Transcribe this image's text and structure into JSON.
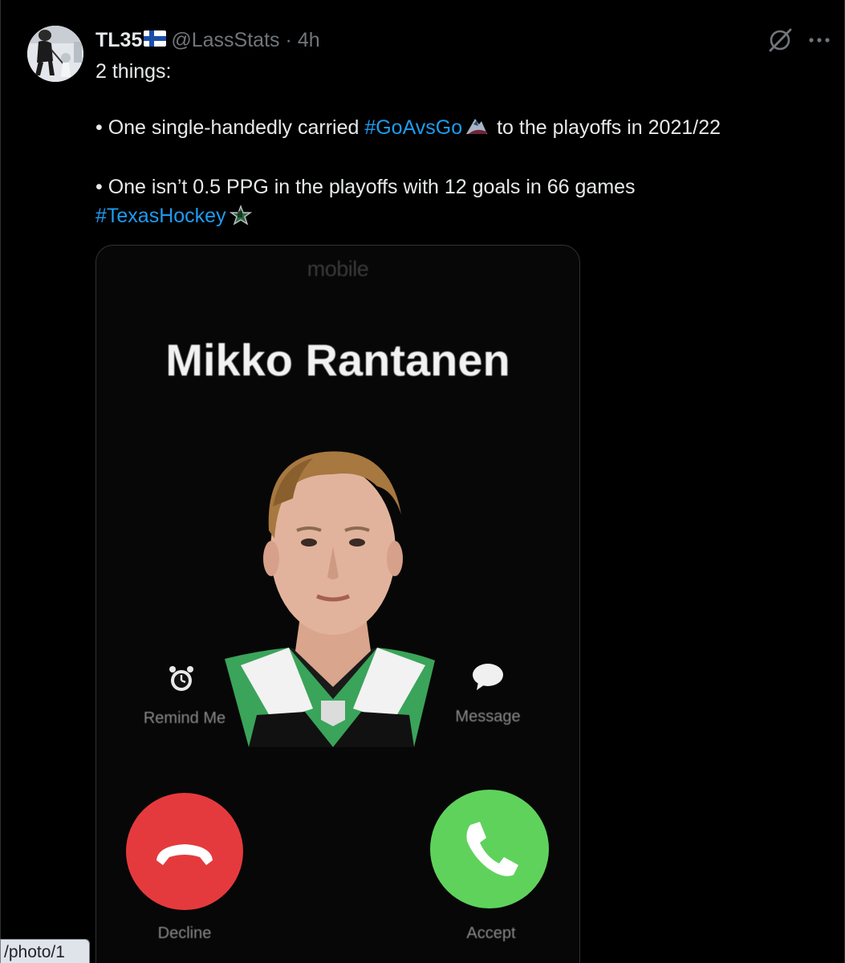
{
  "tweet": {
    "author": {
      "display_name": "TL35",
      "flag_icon": "finland-flag-icon",
      "handle": "@LassStats",
      "separator": "·",
      "time": "4h",
      "avatar_icon": "hockey-player-avatar"
    },
    "actions": {
      "grok_icon": "grok-icon",
      "more_icon": "more-options-icon"
    },
    "text": {
      "line1": "2 things:",
      "bullet1_prefix": "• One single-handedly carried ",
      "bullet1_hashtag": "#GoAvsGo",
      "bullet1_emoji": "avalanche-logo-icon",
      "bullet1_suffix": " to the playoffs in 2021/22",
      "bullet2": "• One isn’t 0.5 PPG in the playoffs with 12 goals in 66 games",
      "hashtag2": "#TexasHockey",
      "hashtag2_emoji": "dallas-stars-logo-icon"
    },
    "media": {
      "carrier": "mobile",
      "caller_name": "Mikko Rantanen",
      "remind_label": "Remind Me",
      "message_label": "Message",
      "decline_label": "Decline",
      "accept_label": "Accept",
      "colors": {
        "decline": "#e53a3d",
        "accept": "#5fd25c",
        "jersey_green": "#3aa45a"
      }
    }
  },
  "status_url": "/photo/1",
  "colors": {
    "background": "#000000",
    "text": "#e7e9ea",
    "secondary_text": "#71767b",
    "link": "#1d9bf0"
  }
}
